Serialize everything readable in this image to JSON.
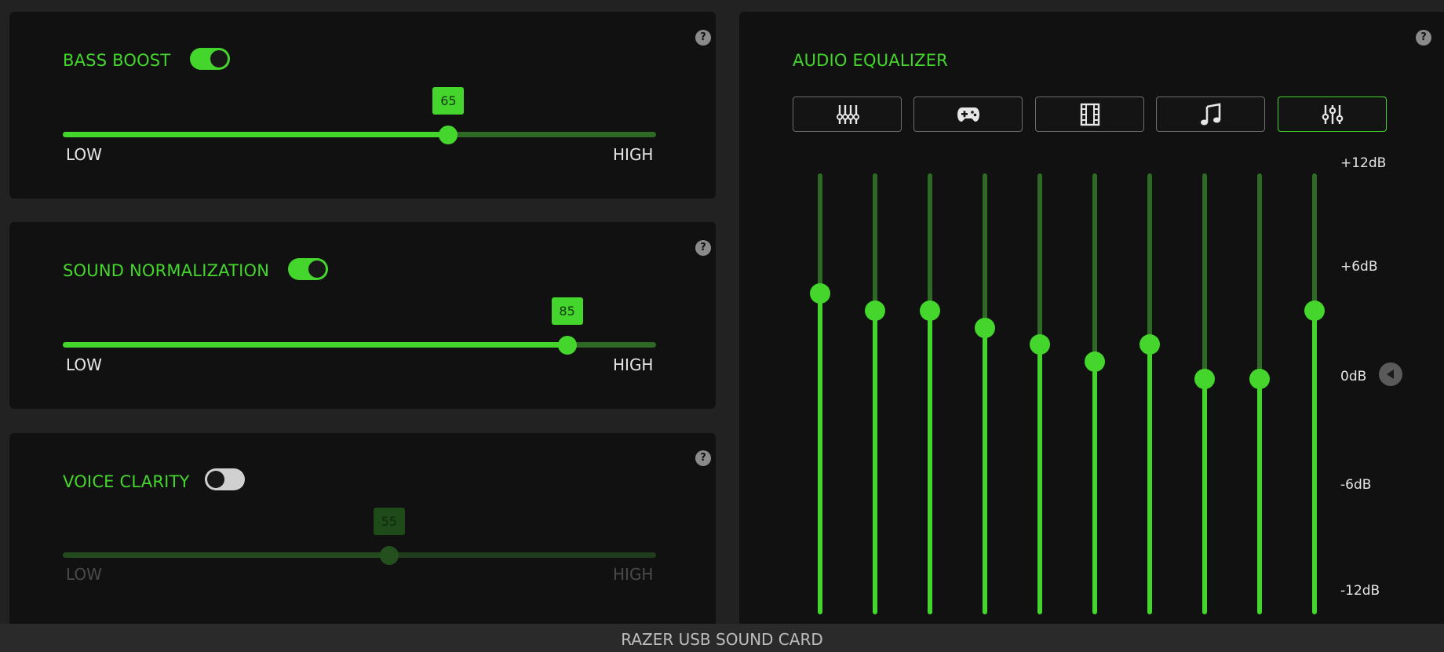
{
  "panels": {
    "bass_boost": {
      "title": "BASS BOOST",
      "enabled": true,
      "value": 65,
      "value_label": "65",
      "low_label": "LOW",
      "high_label": "HIGH",
      "help": "?"
    },
    "sound_normalization": {
      "title": "SOUND NORMALIZATION",
      "enabled": true,
      "value": 85,
      "value_label": "85",
      "low_label": "LOW",
      "high_label": "HIGH",
      "help": "?"
    },
    "voice_clarity": {
      "title": "VOICE CLARITY",
      "enabled": false,
      "value": 55,
      "value_label": "55",
      "low_label": "LOW",
      "high_label": "HIGH",
      "help": "?"
    }
  },
  "equalizer": {
    "title": "AUDIO EQUALIZER",
    "help": "?",
    "presets": [
      {
        "icon": "equalizer-sliders-icon",
        "selected": false
      },
      {
        "icon": "gamepad-icon",
        "selected": false
      },
      {
        "icon": "film-icon",
        "selected": false
      },
      {
        "icon": "music-note-icon",
        "selected": false
      },
      {
        "icon": "custom-sliders-icon",
        "selected": true
      }
    ],
    "bands_db": [
      5,
      4,
      4,
      3,
      2,
      1,
      2,
      0,
      0,
      4
    ],
    "range_db": [
      -12,
      12
    ],
    "scale_labels": {
      "p12": "+12dB",
      "p6": "+6dB",
      "zero": "0dB",
      "m6": "-6dB",
      "m12": "-12dB"
    }
  },
  "colors": {
    "accent": "#44d62c",
    "panel_bg": "#111111",
    "page_bg": "#222222"
  },
  "footer": {
    "device_name": "RAZER USB SOUND CARD"
  }
}
